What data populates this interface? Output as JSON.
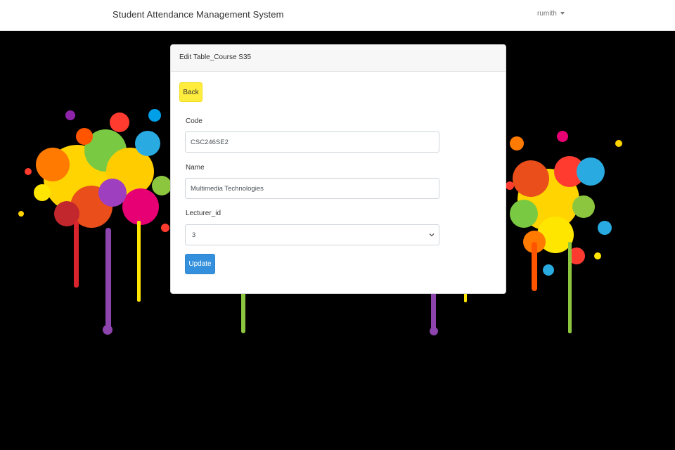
{
  "navbar": {
    "brand": "Student Attendance Management System",
    "user": "rumith"
  },
  "card": {
    "title": "Edit Table_Course S35",
    "back_label": "Back",
    "fields": {
      "code": {
        "label": "Code",
        "value": "CSC246SE2"
      },
      "name": {
        "label": "Name",
        "value": "Multimedia Technologies"
      },
      "lecturer": {
        "label": "Lecturer_id",
        "selected": "3"
      }
    },
    "update_label": "Update"
  },
  "colors": {
    "back_button": "#ffec3d",
    "update_button": "#3490dc",
    "background": "#000000"
  },
  "icons": [
    "caret-down-icon",
    "select-chevron-icon"
  ]
}
